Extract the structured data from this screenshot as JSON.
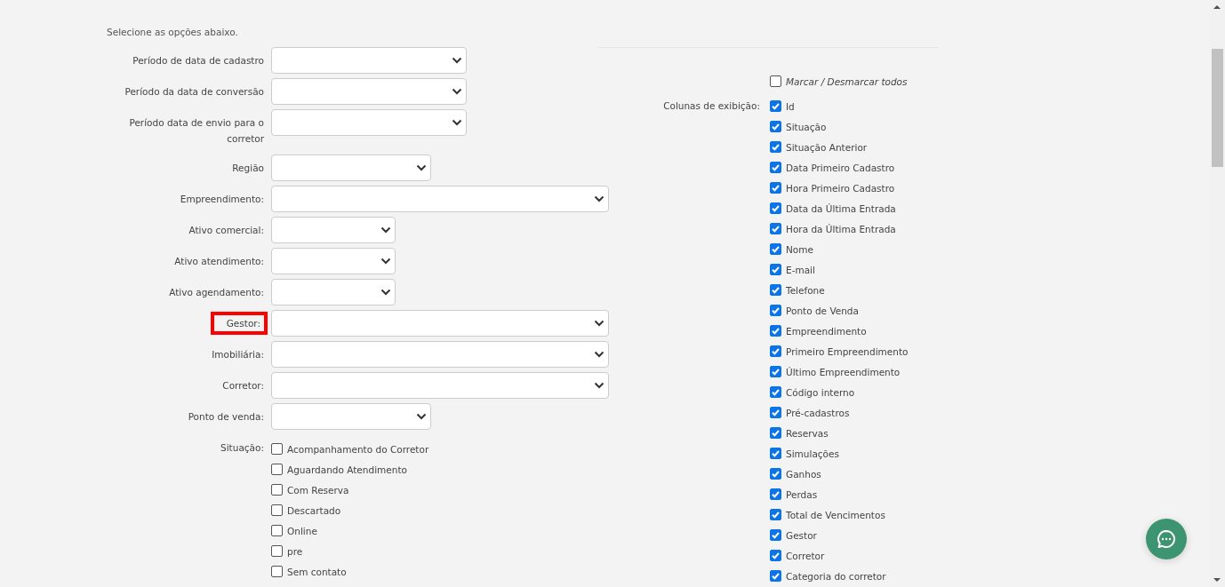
{
  "intro": "Selecione as opções abaixo.",
  "filters": [
    {
      "label": "Período de data de cadastro",
      "kind": "medium",
      "highlighted": false
    },
    {
      "label": "Período da data de conversão",
      "kind": "medium",
      "highlighted": false
    },
    {
      "label": "Período data de envio para o corretor",
      "kind": "medium",
      "highlighted": false
    },
    {
      "label": "Região",
      "kind": "small",
      "highlighted": false
    },
    {
      "label": "Empreendimento:",
      "kind": "wide",
      "highlighted": false
    },
    {
      "label": "Ativo comercial:",
      "kind": "tiny",
      "highlighted": false
    },
    {
      "label": "Ativo atendimento:",
      "kind": "tiny",
      "highlighted": false
    },
    {
      "label": "Ativo agendamento:",
      "kind": "tiny",
      "highlighted": false
    },
    {
      "label": "Gestor:",
      "kind": "wide",
      "highlighted": true
    },
    {
      "label": "Imobiliária:",
      "kind": "wide",
      "highlighted": false
    },
    {
      "label": "Corretor:",
      "kind": "wide",
      "highlighted": false
    },
    {
      "label": "Ponto de venda:",
      "kind": "small",
      "highlighted": false
    }
  ],
  "situacao": {
    "label": "Situação:",
    "options": [
      {
        "label": "Acompanhamento do Corretor",
        "checked": false
      },
      {
        "label": "Aguardando Atendimento",
        "checked": false
      },
      {
        "label": "Com Reserva",
        "checked": false
      },
      {
        "label": "Descartado",
        "checked": false
      },
      {
        "label": "Online",
        "checked": false
      },
      {
        "label": "pre",
        "checked": false
      },
      {
        "label": "Sem contato",
        "checked": false
      }
    ]
  },
  "toggle_all": {
    "label": "Marcar / Desmarcar todos",
    "checked": false
  },
  "columns": {
    "label": "Colunas de exibição:",
    "options": [
      {
        "label": "Id",
        "checked": true
      },
      {
        "label": "Situação",
        "checked": true
      },
      {
        "label": "Situação Anterior",
        "checked": true
      },
      {
        "label": "Data Primeiro Cadastro",
        "checked": true
      },
      {
        "label": "Hora Primeiro Cadastro",
        "checked": true
      },
      {
        "label": "Data da Última Entrada",
        "checked": true
      },
      {
        "label": "Hora da Última Entrada",
        "checked": true
      },
      {
        "label": "Nome",
        "checked": true
      },
      {
        "label": "E-mail",
        "checked": true
      },
      {
        "label": "Telefone",
        "checked": true
      },
      {
        "label": "Ponto de Venda",
        "checked": true
      },
      {
        "label": "Empreendimento",
        "checked": true
      },
      {
        "label": "Primeiro Empreendimento",
        "checked": true
      },
      {
        "label": "Último Empreendimento",
        "checked": true
      },
      {
        "label": "Código interno",
        "checked": true
      },
      {
        "label": "Pré-cadastros",
        "checked": true
      },
      {
        "label": "Reservas",
        "checked": true
      },
      {
        "label": "Simulações",
        "checked": true
      },
      {
        "label": "Ganhos",
        "checked": true
      },
      {
        "label": "Perdas",
        "checked": true
      },
      {
        "label": "Total de Vencimentos",
        "checked": true
      },
      {
        "label": "Gestor",
        "checked": true
      },
      {
        "label": "Corretor",
        "checked": true
      },
      {
        "label": "Categoria do corretor",
        "checked": true
      }
    ]
  }
}
